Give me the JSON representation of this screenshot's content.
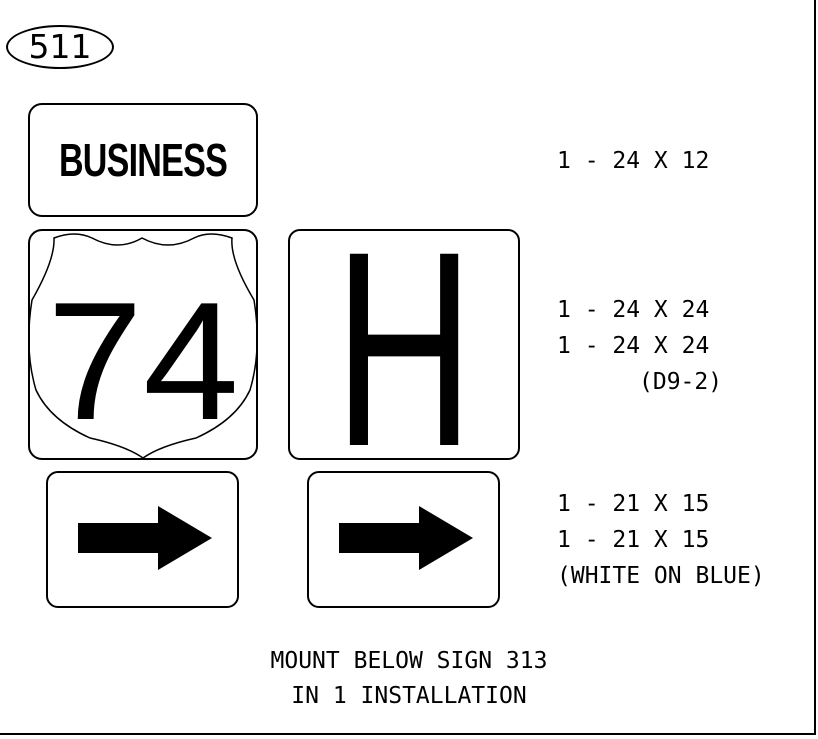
{
  "sign_number": "511",
  "signs": {
    "business_label": "BUSINESS",
    "route_number": "74",
    "letter": "H"
  },
  "specs": {
    "row1": [
      "1 - 24 X 12"
    ],
    "row2": [
      "1 - 24 X 24",
      "1 - 24 X 24",
      "(D9-2)"
    ],
    "row3": [
      "1 - 21 X 15",
      "1 - 21 X 15",
      "(WHITE ON BLUE)"
    ]
  },
  "note": {
    "line1": "MOUNT BELOW SIGN 313",
    "line2": "IN 1 INSTALLATION"
  },
  "icons": {
    "shield": "us-route-shield-icon",
    "arrow": "arrow-right-icon"
  }
}
